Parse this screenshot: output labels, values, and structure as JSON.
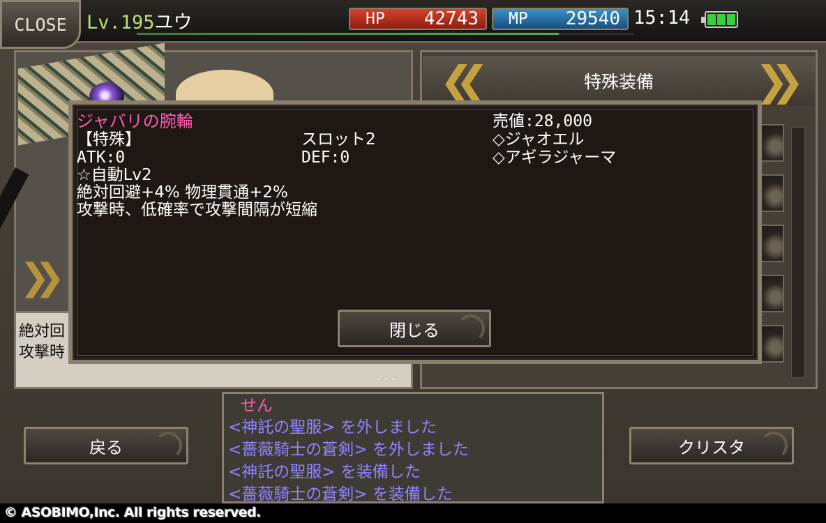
{
  "topbar": {
    "close_label": "CLOSE",
    "level": "Lv.195",
    "player_name": "ユウ",
    "hp_label": "HP",
    "hp_value": "42743",
    "mp_label": "MP",
    "mp_value": "29540",
    "time": "15:14",
    "battery_level": 1.0
  },
  "left_panel": {
    "description_line1": "絶対回",
    "description_line2": "攻撃時",
    "more_indicator": "..."
  },
  "right_panel": {
    "title": "特殊装備",
    "slot_count": 5
  },
  "item_modal": {
    "item_name": "ジャバリの腕輪",
    "category": "【特殊】",
    "atk": "ATK:0",
    "slots": "スロット2",
    "def": "DEF:0",
    "sell_price": "売値:28,000",
    "tag1": "◇ジャオエル",
    "tag2": "◇アギラジャーマ",
    "auto_skill": "☆自動Lv2",
    "effect1": "絶対回避+4% 物理貫通+2%",
    "effect2": "攻撃時、低確率で攻撃間隔が短縮",
    "close_button": "閉じる"
  },
  "bottom": {
    "back_button": "戻る",
    "crysta_button": "クリスタ",
    "log": {
      "speaker": "せん",
      "lines": [
        "<神託の聖服> を外しました",
        "<薔薇騎士の蒼剣> を外しました",
        "<神託の聖服> を装備した",
        "<薔薇騎士の蒼剣> を装備した"
      ]
    },
    "copyright": "© ASOBIMO,Inc. All rights reserved."
  },
  "colors": {
    "item_name": "#ff5db1",
    "log_text": "#8f83ff",
    "level_text": "#b5e27a",
    "hp_bar": "#d6412c",
    "mp_bar": "#3891c8"
  }
}
